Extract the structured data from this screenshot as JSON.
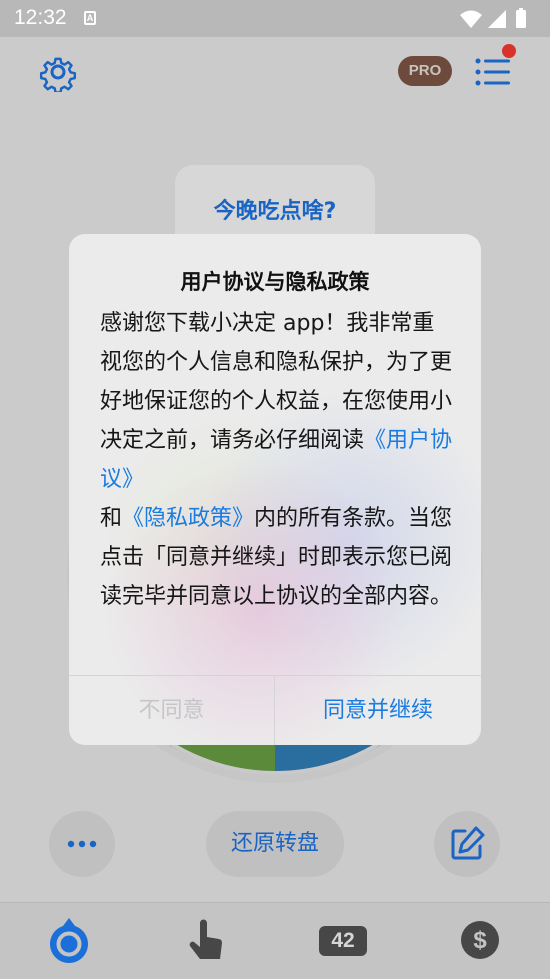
{
  "status_bar": {
    "time": "12:32",
    "notification_letter": "A"
  },
  "header": {
    "pro_label": "PRO"
  },
  "card": {
    "question": "今晚吃点啥?"
  },
  "dialog": {
    "title": "用户协议与隐私政策",
    "body_text_1": "感谢您下载小决定 app！我非常重视您的个人信息和隐私保护，为了更好地保证您的个人权益，在您使用小决定之前，请务必仔细阅读",
    "link_user_agreement": "《用户协议》",
    "conjunction": "和",
    "link_privacy_policy": "《隐私政策》",
    "body_text_2": "内的所有条款。当您点击「同意并继续」时即表示您已阅读完毕并同意以上协议的全部内容。",
    "disagree_label": "不同意",
    "agree_label": "同意并继续"
  },
  "actions": {
    "restore_label": "还原转盘"
  },
  "tabs": {
    "counter_badge": "42"
  },
  "colors": {
    "accent": "#1a7ce0",
    "brand_blue": "#1a64c4",
    "pro_badge": "#6e4a3c",
    "notification_dot": "#d8322b"
  }
}
